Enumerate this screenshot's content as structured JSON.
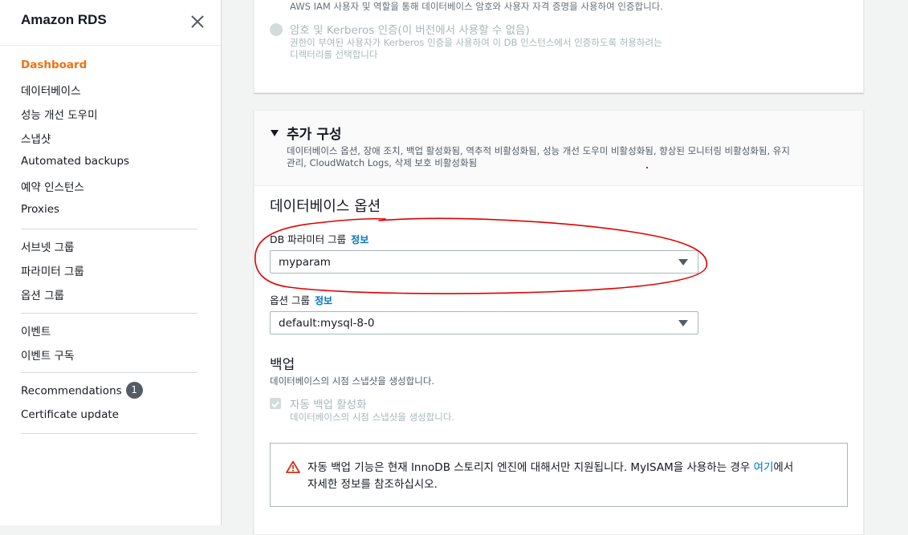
{
  "sidebar": {
    "title": "Amazon RDS",
    "items_group1": [
      "Dashboard",
      "데이터베이스",
      "성능 개선 도우미",
      "스냅샷",
      "Automated backups",
      "예약 인스턴스",
      "Proxies"
    ],
    "items_group2": [
      "서브넷 그룹",
      "파라미터 그룹",
      "옵션 그룹"
    ],
    "items_group3": [
      "이벤트",
      "이벤트 구독"
    ],
    "recommendations": {
      "label": "Recommendations",
      "count": "1"
    },
    "certificate": "Certificate update"
  },
  "auth": {
    "iam_desc": "AWS IAM 사용자 및 역할을 통해 데이터베이스 암호와 사용자 자격 증명을 사용하여 인증합니다.",
    "kerberos_label": "암호 및 Kerberos 인증(이 버전에서 사용할 수 없음)",
    "kerberos_desc_line1": "권한이 부여된 사용자가 Kerberos 인증을 사용하여 이 DB 인스턴스에서 인증하도록 허용하려는",
    "kerberos_desc_line2": "디렉터리를 선택합니다"
  },
  "additional_config": {
    "title": "추가 구성",
    "desc_line1": "데이터베이스 옵션, 장애 조치, 백업 활성화됨, 역추적 비활성화됨, 성능 개선 도우미 비활성화됨, 향상된 모니터링 비활성화됨, 유지",
    "desc_line2": "관리, CloudWatch Logs, 삭제 보호 비활성화됨"
  },
  "db_options": {
    "heading": "데이터베이스 옵션",
    "param_group_label": "DB 파라미터 그룹",
    "param_group_info": "정보",
    "param_group_value": "myparam",
    "option_group_label": "옵션 그룹",
    "option_group_info": "정보",
    "option_group_value": "default:mysql-8-0"
  },
  "backup": {
    "heading": "백업",
    "desc": "데이터베이스의 시점 스냅샷을 생성합니다.",
    "auto_label": "자동 백업 활성화",
    "auto_desc": "데이터베이스의 시점 스냅샷을 생성합니다.",
    "auto_checked": true
  },
  "alert": {
    "text_line1_pre": "자동 백업 기능은 현재 InnoDB 스토리지 엔진에 대해서만 지원됩니다. MyISAM을 사용하는 경우 ",
    "link": "여기",
    "text_line1_post": "에서",
    "text_line2": "자세한 정보를 참조하십시오."
  },
  "colors": {
    "accent": "#ec7211",
    "link": "#0073bb",
    "annotation": "#e00000",
    "warning": "#d13212"
  }
}
